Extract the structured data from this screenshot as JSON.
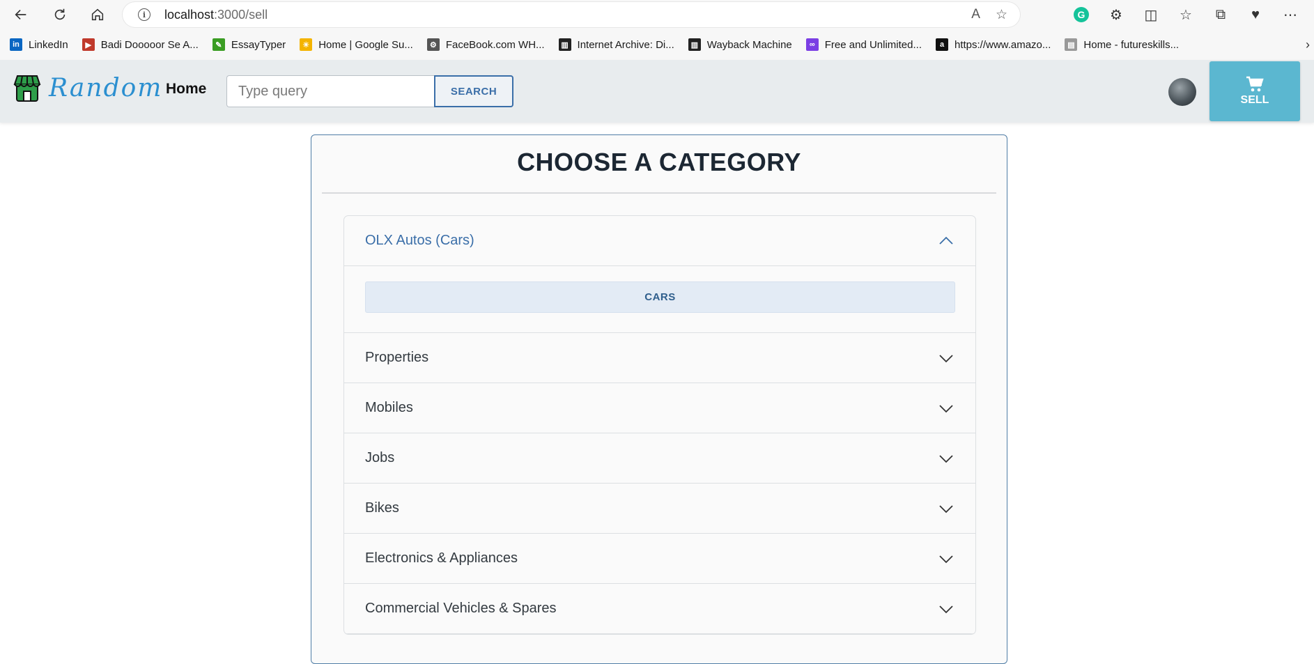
{
  "browser": {
    "url_host": "localhost",
    "url_path": ":3000/sell",
    "bookmarks": [
      {
        "label": "LinkedIn",
        "icon": "linkedin-icon",
        "color": "#0a66c2"
      },
      {
        "label": "Badi Dooooor Se A...",
        "icon": "video-icon",
        "color": "#c0392b"
      },
      {
        "label": "EssayTyper",
        "icon": "pencil-icon",
        "color": "#3a9d23"
      },
      {
        "label": "Home | Google Su...",
        "icon": "sun-icon",
        "color": "#f4b400"
      },
      {
        "label": "FaceBook.com WH...",
        "icon": "gear-icon",
        "color": "#555555"
      },
      {
        "label": "Internet Archive: Di...",
        "icon": "archive-icon",
        "color": "#222222"
      },
      {
        "label": "Wayback Machine",
        "icon": "archive-icon",
        "color": "#222222"
      },
      {
        "label": "Free and Unlimited...",
        "icon": "infinity-icon",
        "color": "#7b3fe4"
      },
      {
        "label": "https://www.amazo...",
        "icon": "amazon-icon",
        "color": "#111111"
      },
      {
        "label": "Home - futureskills...",
        "icon": "page-icon",
        "color": "#999999"
      }
    ]
  },
  "header": {
    "brand": "Random",
    "home_label": "Home",
    "search_placeholder": "Type query",
    "search_button": "SEARCH",
    "sell_label": "SELL",
    "accent_color": "#5bb7d0"
  },
  "main": {
    "title": "CHOOSE A CATEGORY",
    "categories": [
      {
        "label": "OLX Autos (Cars)",
        "expanded": true,
        "sub": [
          "CARS"
        ]
      },
      {
        "label": "Properties",
        "expanded": false
      },
      {
        "label": "Mobiles",
        "expanded": false
      },
      {
        "label": "Jobs",
        "expanded": false
      },
      {
        "label": "Bikes",
        "expanded": false
      },
      {
        "label": "Electronics & Appliances",
        "expanded": false
      },
      {
        "label": "Commercial Vehicles & Spares",
        "expanded": false
      }
    ]
  }
}
